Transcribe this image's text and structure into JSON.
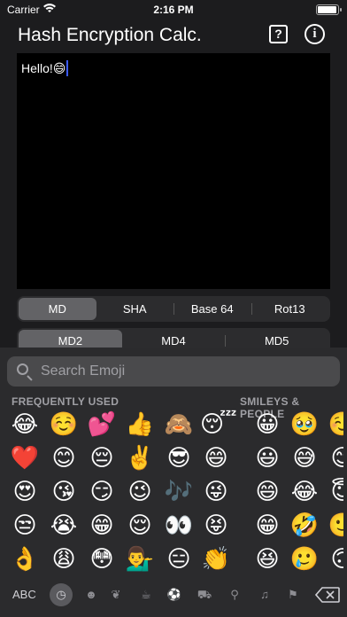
{
  "status": {
    "carrier": "Carrier",
    "time": "2:16 PM"
  },
  "nav": {
    "title": "Hash Encryption Calc.",
    "help_icon": "?",
    "info_icon": "i"
  },
  "editor": {
    "text": "Hello!😄"
  },
  "tabs_top": [
    {
      "label": "MD",
      "selected": true
    },
    {
      "label": "SHA",
      "selected": false
    },
    {
      "label": "Base 64",
      "selected": false
    },
    {
      "label": "Rot13",
      "selected": false
    }
  ],
  "tabs_md": [
    {
      "label": "MD2",
      "selected": true
    },
    {
      "label": "MD4",
      "selected": false
    },
    {
      "label": "MD5",
      "selected": false
    }
  ],
  "keyboard": {
    "search_placeholder": "Search Emoji",
    "section_frequent": "FREQUENTLY USED",
    "section_smileys": "SMILEYS & PEOPLE",
    "abc_label": "ABC",
    "frequent_columns": [
      [
        "😂",
        "❤️",
        "😍",
        "😒",
        "👌"
      ],
      [
        "☺️",
        "😊",
        "😘",
        "😭",
        "😩"
      ],
      [
        "💕",
        "😔",
        "😏",
        "😁",
        "😳"
      ],
      [
        "👍",
        "✌️",
        "😉",
        "😌",
        "💁‍♂️"
      ],
      [
        "🙈",
        "😎",
        "🎶",
        "👀",
        "😑"
      ],
      [
        "😴",
        "😄",
        "😜",
        "😝",
        "👏"
      ]
    ],
    "smileys_columns": [
      [
        "😀",
        "😃",
        "😄",
        "😁",
        "😆"
      ],
      [
        "🥹",
        "😅",
        "😂",
        "🤣",
        "🥲"
      ],
      [
        "☺️",
        "😊",
        "😇",
        "🙂",
        "🙃"
      ]
    ],
    "categories": [
      "recent",
      "smileys",
      "animals",
      "food",
      "activity",
      "travel",
      "objects",
      "symbols",
      "flags"
    ]
  }
}
